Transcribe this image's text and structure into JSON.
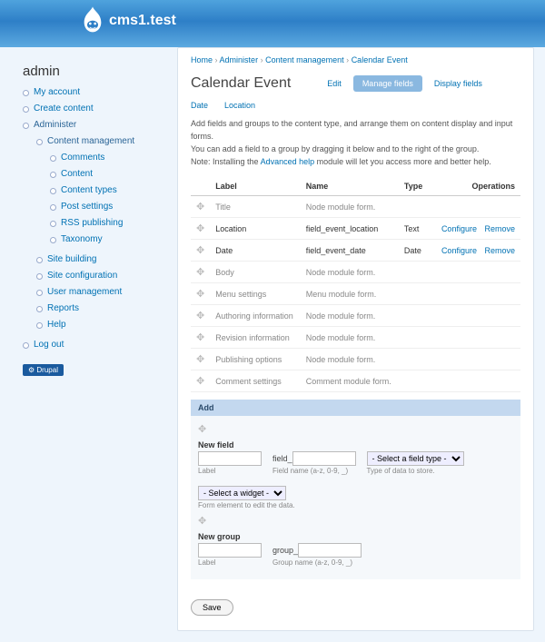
{
  "site": {
    "title": "cms1.test"
  },
  "sidebar": {
    "title": "admin",
    "badge": "Drupal",
    "items": [
      {
        "label": "My account"
      },
      {
        "label": "Create content"
      },
      {
        "label": "Administer",
        "children": [
          {
            "label": "Content management",
            "children": [
              {
                "label": "Comments"
              },
              {
                "label": "Content"
              },
              {
                "label": "Content types"
              },
              {
                "label": "Post settings"
              },
              {
                "label": "RSS publishing"
              },
              {
                "label": "Taxonomy"
              }
            ]
          },
          {
            "label": "Site building"
          },
          {
            "label": "Site configuration"
          },
          {
            "label": "User management"
          },
          {
            "label": "Reports"
          },
          {
            "label": "Help"
          }
        ]
      },
      {
        "label": "Log out"
      }
    ]
  },
  "breadcrumb": {
    "items": [
      "Home",
      "Administer",
      "Content management",
      "Calendar Event"
    ]
  },
  "page": {
    "title": "Calendar Event"
  },
  "tabs": {
    "items": [
      {
        "label": "Edit"
      },
      {
        "label": "Manage fields",
        "active": true
      },
      {
        "label": "Display fields"
      }
    ]
  },
  "subtabs": {
    "items": [
      {
        "label": "Date"
      },
      {
        "label": "Location"
      }
    ]
  },
  "description": {
    "p1": "Add fields and groups to the content type, and arrange them on content display and input forms.",
    "p2": "You can add a field to a group by dragging it below and to the right of the group.",
    "p3a": "Note: Installing the ",
    "p3link": "Advanced help",
    "p3b": " module will let you access more and better help."
  },
  "table": {
    "headers": {
      "label": "Label",
      "name": "Name",
      "type": "Type",
      "ops": "Operations"
    },
    "rows": [
      {
        "label": "Title",
        "name": "Node module form.",
        "type": "",
        "en": false
      },
      {
        "label": "Location",
        "name": "field_event_location",
        "type": "Text",
        "en": true,
        "ops": [
          "Configure",
          "Remove"
        ]
      },
      {
        "label": "Date",
        "name": "field_event_date",
        "type": "Date",
        "en": true,
        "ops": [
          "Configure",
          "Remove"
        ]
      },
      {
        "label": "Body",
        "name": "Node module form.",
        "type": "",
        "en": false
      },
      {
        "label": "Menu settings",
        "name": "Menu module form.",
        "type": "",
        "en": false
      },
      {
        "label": "Authoring information",
        "name": "Node module form.",
        "type": "",
        "en": false
      },
      {
        "label": "Revision information",
        "name": "Node module form.",
        "type": "",
        "en": false
      },
      {
        "label": "Publishing options",
        "name": "Node module form.",
        "type": "",
        "en": false
      },
      {
        "label": "Comment settings",
        "name": "Comment module form.",
        "type": "",
        "en": false
      }
    ]
  },
  "add": {
    "title": "Add",
    "newfield": {
      "title": "New field",
      "label_help": "Label",
      "prefix": "field_",
      "name_help": "Field name (a-z, 0-9, _)",
      "type_ph": "- Select a field type -",
      "type_help": "Type of data to store.",
      "widget_ph": "- Select a widget -",
      "widget_help": "Form element to edit the data."
    },
    "newgroup": {
      "title": "New group",
      "label_help": "Label",
      "prefix": "group_",
      "name_help": "Group name (a-z, 0-9, _)"
    }
  },
  "buttons": {
    "save": "Save"
  }
}
